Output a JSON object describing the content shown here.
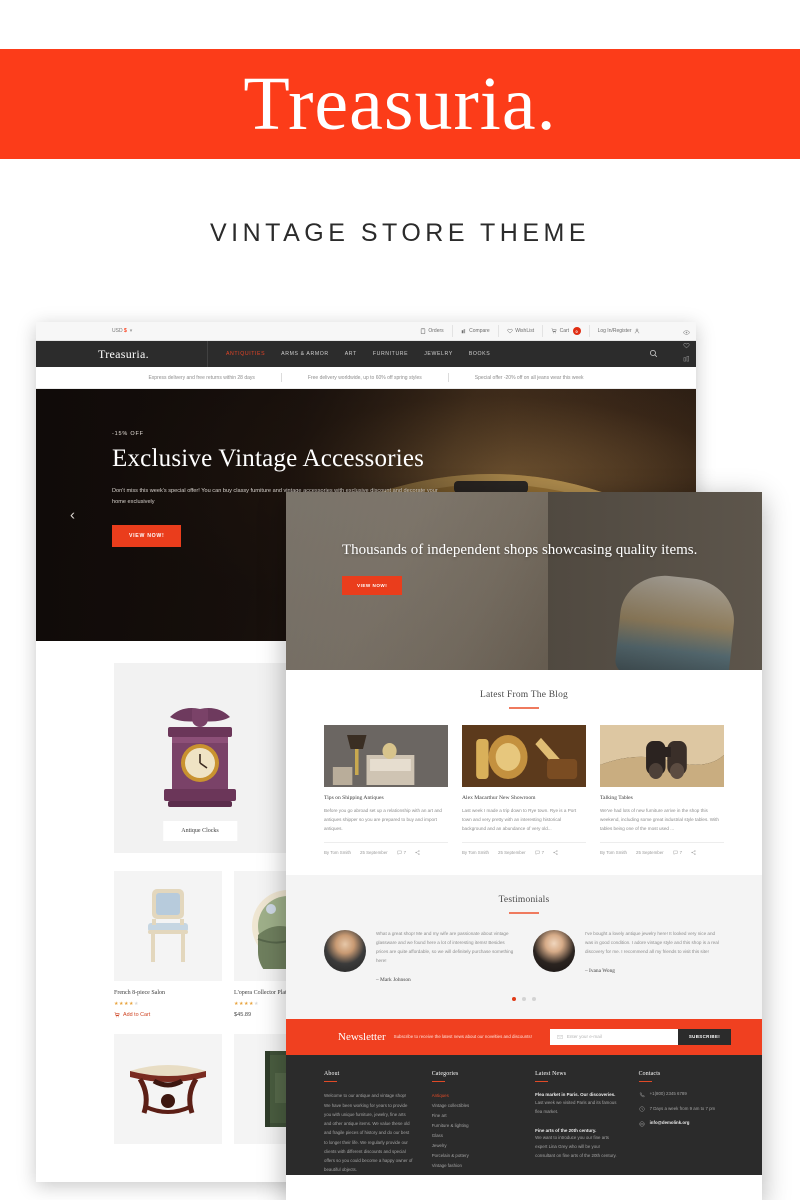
{
  "banner": {
    "wordmark": "Treasuria.",
    "subtitle": "VINTAGE STORE THEME",
    "accent_color": "#fc3c19"
  },
  "back_window": {
    "utility_bar": {
      "currency": "USD",
      "currency_symbol": "$",
      "items": [
        {
          "label": "Orders",
          "icon": "clipboard-icon"
        },
        {
          "label": "Compare",
          "icon": "compare-icon"
        },
        {
          "label": "WishList",
          "icon": "heart-icon"
        },
        {
          "label": "Cart",
          "icon": "cart-icon",
          "badge": "0"
        },
        {
          "label": "Log In/Register",
          "icon": "login-icon"
        }
      ]
    },
    "nav": {
      "logo": "Treasuria.",
      "links": [
        {
          "label": "ANTIQUITIES",
          "active": true
        },
        {
          "label": "ARMS & ARMOR",
          "active": false
        },
        {
          "label": "ART",
          "active": false
        },
        {
          "label": "FURNITURE",
          "active": false
        },
        {
          "label": "JEWELRY",
          "active": false
        },
        {
          "label": "BOOKS",
          "active": false
        }
      ],
      "search_icon": "search-icon"
    },
    "promo_strip": [
      "Express delivery and free returns within 28 days",
      "Free delivery worldwide, up to 60% off spring styles",
      "Special offer -20% off on all jeans wear this week"
    ],
    "hero": {
      "kicker": "-15% OFF",
      "title": "Exclusive Vintage Accessories",
      "text": "Don't miss this week's special offer! You can buy classy furniture and vintage accessories with exclusive discount and decorate your home exclusively",
      "button": "VIEW NOW!",
      "prev_arrow": "chevron-left-icon"
    },
    "category_card": {
      "label": "Antique Clocks"
    },
    "products": [
      {
        "title": "French 8-piece Salon",
        "rating": 4,
        "action": "Add to Cart",
        "price": ""
      },
      {
        "title": "L'opera Collector Plate",
        "rating": 4,
        "action": "",
        "price": "$45.89"
      }
    ],
    "product_card_actions": [
      "eye-icon",
      "heart-icon",
      "compare-icon"
    ]
  },
  "front_window": {
    "hero": {
      "title": "Thousands of independent shops showcasing quality items.",
      "button": "VIEW NOW!"
    },
    "blog": {
      "section_title": "Latest From The Blog",
      "posts": [
        {
          "title": "Tips on Shipping Antiques",
          "excerpt": "Before you go abroad set up a relationship with an art and antiques shipper so you are prepared to buy and import antiques.",
          "author": "By Tom Smith",
          "date": "25 September",
          "comments": "7",
          "share_icon": "share-icon",
          "comment_icon": "comment-icon"
        },
        {
          "title": "Alex Macarthur New Showroom",
          "excerpt": "Last week I made a trip down to Rye town. Rye is a Port town and very pretty with an interesting historical background and an abundance of very old...",
          "author": "By Tom Smith",
          "date": "25 September",
          "comments": "7",
          "share_icon": "share-icon",
          "comment_icon": "comment-icon"
        },
        {
          "title": "Talking Tables",
          "excerpt": "We've had lots of new furniture arrive in the shop this weekend, including some great industrial style tables. With tables being one of the most used ...",
          "author": "By Tom Smith",
          "date": "25 September",
          "comments": "7",
          "share_icon": "share-icon",
          "comment_icon": "comment-icon"
        }
      ]
    },
    "testimonials": {
      "section_title": "Testimonials",
      "items": [
        {
          "text": "What a great shop! Me and my wife are passionate about vintage glassware and we found here a lot of interesting items! Besides prices are quite affordable, so we will definitely purchase something here!",
          "name": "– Mark Johnson"
        },
        {
          "text": "I've bought a lovely antique jewelry here! It looked very nice and was in good condition. I adore vintage style and this shop is a real discovery for me. I recommend all my friends to visit this site!",
          "name": "– Ivana Wong"
        }
      ],
      "dots": 3,
      "active_dot": 0
    },
    "newsletter": {
      "title": "Newsletter",
      "subtitle": "Subscribe to receive the latest news about our novelties and discounts!",
      "placeholder": "Enter your e-mail",
      "button": "SUBSCRIBE!",
      "input_icon": "envelope-icon"
    },
    "footer": {
      "about": {
        "heading": "About",
        "text": "Welcome to our antique and vintage shop! We have been working for years to provide you with unique furniture, jewelry, fine arts and other antique items. We value these old and fragile pieces of history and do our best to longer their life. We regularly provide our clients with different discounts and special offers so you could become a happy owner of beautiful objects."
      },
      "categories": {
        "heading": "Categories",
        "items": [
          {
            "label": "Antiques",
            "active": true
          },
          {
            "label": "Vintage collectibles",
            "active": false
          },
          {
            "label": "Fine art",
            "active": false
          },
          {
            "label": "Furniture & lighting",
            "active": false
          },
          {
            "label": "Glass",
            "active": false
          },
          {
            "label": "Jewelry",
            "active": false
          },
          {
            "label": "Porcelain & pottery",
            "active": false
          },
          {
            "label": "Vintage fashion",
            "active": false
          }
        ]
      },
      "latest_news": {
        "heading": "Latest News",
        "items": [
          {
            "title": "Flea market in Paris. Our discoveries.",
            "body": "Last week we visited Paris and its famous flea market."
          },
          {
            "title": "Fine arts of the 20th century.",
            "body": "We want to introduce you our fine arts expert Lina Grey who will be your consultant on fine arts of the 20th century."
          }
        ]
      },
      "contacts": {
        "heading": "Contacts",
        "items": [
          {
            "icon": "phone-icon",
            "text": "+1(800) 2345 6789"
          },
          {
            "icon": "clock-icon",
            "text": "7 Days a week from 9 am to 7 pm"
          },
          {
            "icon": "envelope-icon",
            "text": "info@demolink.org"
          }
        ]
      }
    }
  }
}
